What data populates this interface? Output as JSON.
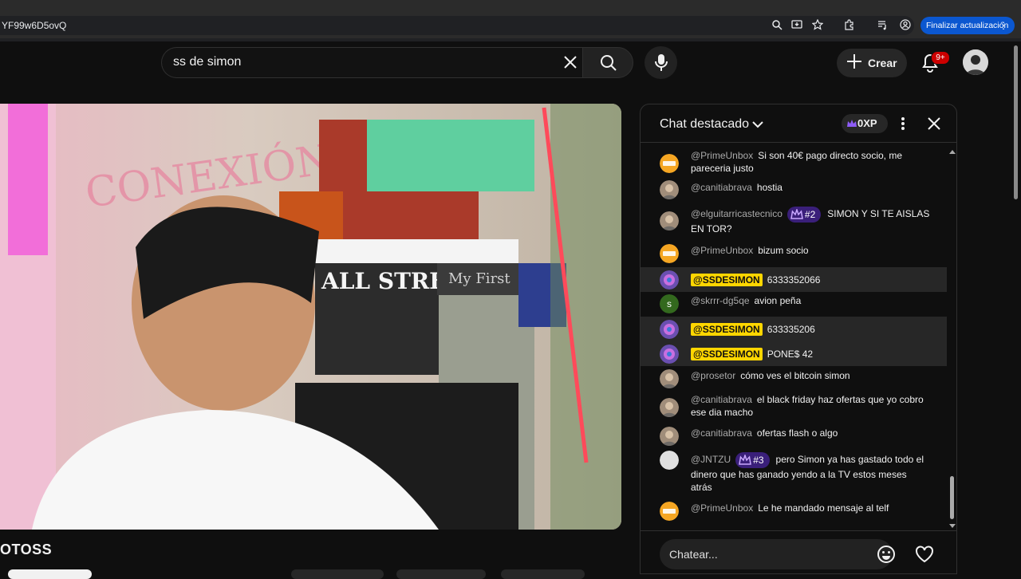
{
  "browser": {
    "url": "YF99w6D5ovQ",
    "update_button": "Finalizar actualización",
    "icons": [
      "zoom-icon",
      "install-icon",
      "bookmark-star-icon",
      "extensions-icon",
      "media-control-icon",
      "profile-icon"
    ]
  },
  "header": {
    "search_query": "ss de simon",
    "create_label": "Crear",
    "notifications_badge": "9+"
  },
  "video": {
    "wall_sign_1": "ALL STREET",
    "wall_sign_2": "My First"
  },
  "channel": {
    "name": "OTOSS"
  },
  "chat": {
    "title": "Chat destacado",
    "xp_label": "0XP",
    "input_placeholder": "Chatear...",
    "colors": {
      "owner_badge": "#ffd600",
      "rank_badge": "#3a1f7a",
      "highlight_row": "#272727"
    },
    "messages": [
      {
        "author": "@PrimeUnbox",
        "text": "Si son 40€ pago directo socio, me pareceria justo",
        "avatar": "prime-unbox-avatar"
      },
      {
        "author": "@canitiabrava",
        "text": "hostia",
        "avatar": "user-photo-avatar"
      },
      {
        "author": "@elguitarricastecnico",
        "rank": "#2",
        "text": "SIMON Y SI TE AISLAS EN TOR?",
        "avatar": "user-photo-avatar"
      },
      {
        "author": "@PrimeUnbox",
        "text": "bizum socio",
        "avatar": "prime-unbox-avatar"
      },
      {
        "author": "@SSDESIMON",
        "owner": true,
        "text": "6333352066",
        "avatar": "owner-avatar"
      },
      {
        "author": "@skrrr-dg5qe",
        "text": "avion peña",
        "avatar": "letter-avatar",
        "avatar_letter": "s"
      },
      {
        "author": "@SSDESIMON",
        "owner": true,
        "text": "633335206",
        "avatar": "owner-avatar"
      },
      {
        "author": "@SSDESIMON",
        "owner": true,
        "text": "PONE$ 42",
        "avatar": "owner-avatar"
      },
      {
        "author": "@prosetor",
        "text": "cómo ves el bitcoin simon",
        "avatar": "user-photo-avatar"
      },
      {
        "author": "@canitiabrava",
        "text": "el black friday haz ofertas que yo cobro ese dia macho",
        "avatar": "user-photo-avatar"
      },
      {
        "author": "@canitiabrava",
        "text": "ofertas flash o algo",
        "avatar": "user-photo-avatar"
      },
      {
        "author": "@JNTZU",
        "rank": "#3",
        "text": "pero Simon ya has gastado todo el dinero que has ganado yendo a la TV estos meses atrás",
        "avatar": "default-avatar"
      },
      {
        "author": "@PrimeUnbox",
        "text": "Le he mandado mensaje al telf",
        "avatar": "prime-unbox-avatar"
      }
    ]
  }
}
